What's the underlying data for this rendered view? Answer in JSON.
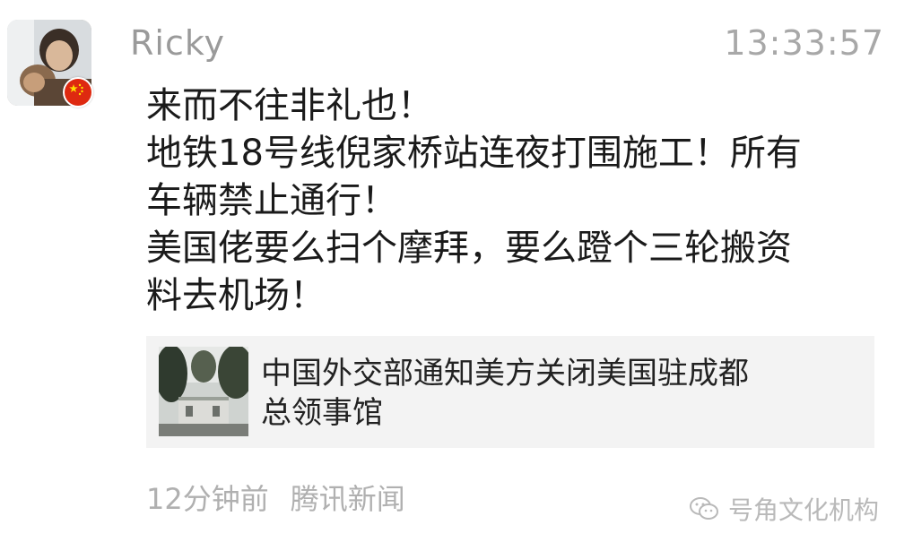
{
  "post": {
    "author": "Ricky",
    "time": "13:33:57",
    "avatar_badge_icon": "china-flag-icon",
    "message_lines": [
      "来而不往非礼也！",
      "地铁18号线倪家桥站连夜打围施工！所有",
      "车辆禁止通行！",
      "美国佬要么扫个摩拜，要么蹬个三轮搬资",
      "料去机场！"
    ]
  },
  "link_card": {
    "title_lines": [
      "中国外交部通知美方关闭美国驻成都",
      "总领事馆"
    ],
    "thumbnail_icon": "news-photo-thumbnail"
  },
  "meta": {
    "time_ago": "12分钟前",
    "source": "腾讯新闻"
  },
  "watermark": {
    "text": "号角文化机构",
    "icon": "wechat-icon"
  },
  "colors": {
    "name_gray": "#9a9a9a",
    "text": "#1a1a1a",
    "card_bg": "#f3f3f3",
    "meta_gray": "#b0b0b0",
    "flag_red": "#de2910",
    "flag_yellow": "#ffde00"
  }
}
